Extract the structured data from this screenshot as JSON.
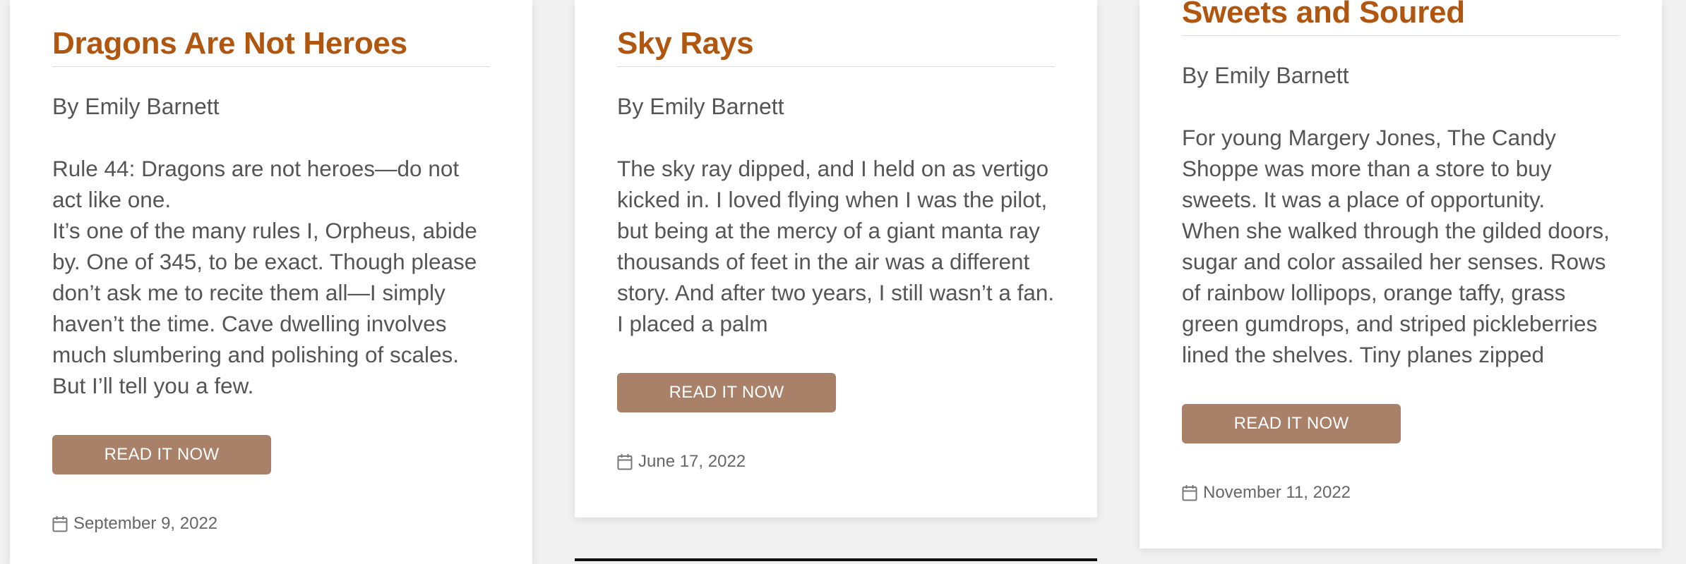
{
  "cards": [
    {
      "title": "Dragons Are Not Heroes",
      "author": "By Emily Barnett",
      "excerpt": [
        "Rule 44: Dragons are not heroes—do not act like one.",
        "It’s one of the many rules I, Orpheus, abide by. One of 345, to be exact. Though please don’t ask me to recite them all—I simply haven’t the time. Cave dwelling involves much slumbering and polishing of scales.",
        "But I’ll tell you a few."
      ],
      "button_label": "READ IT NOW",
      "date": "September 9, 2022",
      "date_icon": "calendar-icon"
    },
    {
      "title": "Sky Rays",
      "author": "By Emily Barnett",
      "excerpt": [
        "The sky ray dipped, and I held on as vertigo kicked in. I loved flying when I was the pilot, but being at the mercy of a giant manta ray thousands of feet in the air was a different story. And after two years, I still wasn’t a fan. I placed a palm"
      ],
      "button_label": "READ IT NOW",
      "date": "June 17, 2022",
      "date_icon": "calendar-icon"
    },
    {
      "title": "Sweets and Soured",
      "author": "By Emily Barnett",
      "excerpt": [
        "For young Margery Jones, The Candy Shoppe was more than a store to buy sweets. It was a place of opportunity.",
        "When she walked through the gilded doors, sugar and color assailed her senses. Rows of rainbow lollipops, orange taffy, grass green gumdrops, and striped pickleberries lined the shelves. Tiny planes zipped"
      ],
      "button_label": "READ IT NOW",
      "date": "November 11, 2022",
      "date_icon": "calendar-icon"
    }
  ],
  "colors": {
    "title": "#b0560f",
    "button": "#a98068",
    "text": "#555555",
    "background": "#f1f1f1"
  }
}
